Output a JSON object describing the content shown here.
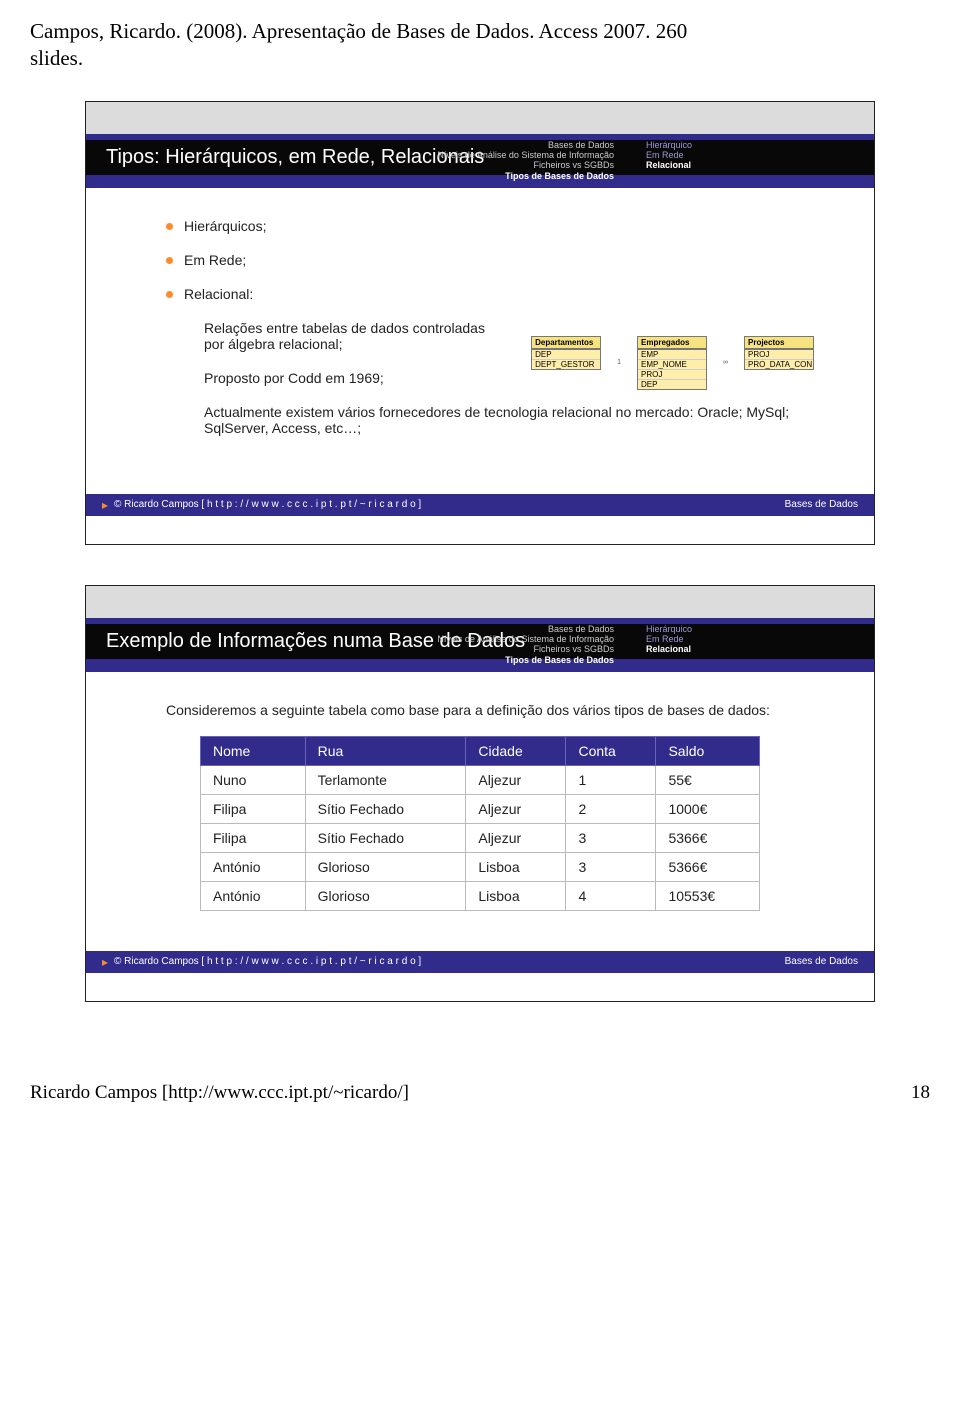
{
  "doc": {
    "citation_line1": "Campos, Ricardo. (2008). Apresentação de Bases de Dados. Access 2007. 260",
    "citation_line2": "slides.",
    "footer_ref": "Ricardo Campos [http://www.ccc.ipt.pt/~ricardo/]",
    "page_number": "18"
  },
  "crumbs_left": {
    "a": "Bases de Dados",
    "b": "Níveis de Análise do Sistema de Informação",
    "c": "Ficheiros vs SGBDs",
    "d": "Tipos de Bases de Dados"
  },
  "crumbs_right": {
    "a": "Hierárquico",
    "b": "Em Rede",
    "c": "Relacional"
  },
  "slide1": {
    "title": "Tipos: Hierárquicos, em Rede, Relacionais",
    "b1": "Hierárquicos;",
    "b2": "Em Rede;",
    "b3": "Relacional:",
    "s1": "Relações entre tabelas de dados controladas por álgebra relacional;",
    "s2": "Proposto por Codd em 1969;",
    "s3": "Actualmente existem vários fornecedores de tecnologia relacional no mercado: Oracle; MySql; SqlServer, Access, etc…;",
    "erd": {
      "dep_head": "Departamentos",
      "dep_r1": "DEP",
      "dep_r2": "DEPT_GESTOR",
      "emp_head": "Empregados",
      "emp_r1": "EMP",
      "emp_r2": "EMP_NOME",
      "emp_r3": "PROJ",
      "emp_r4": "DEP",
      "proj_head": "Projectos",
      "proj_r1": "PROJ",
      "proj_r2": "PRO_DATA_CON",
      "one": "1",
      "inf": "∞"
    },
    "footer_left": "© Ricardo Campos  [ h t t p : / / w w w . c c c . i p t . p t / ~ r i c a r d o ]",
    "footer_right": "Bases de Dados"
  },
  "slide2": {
    "title": "Exemplo de Informações numa Base de Dados",
    "intro": "Consideremos a seguinte tabela como base para a definição dos vários tipos de bases de dados:",
    "columns": [
      "Nome",
      "Rua",
      "Cidade",
      "Conta",
      "Saldo"
    ],
    "rows": [
      [
        "Nuno",
        "Terlamonte",
        "Aljezur",
        "1",
        "55€"
      ],
      [
        "Filipa",
        "Sítio Fechado",
        "Aljezur",
        "2",
        "1000€"
      ],
      [
        "Filipa",
        "Sítio Fechado",
        "Aljezur",
        "3",
        "5366€"
      ],
      [
        "António",
        "Glorioso",
        "Lisboa",
        "3",
        "5366€"
      ],
      [
        "António",
        "Glorioso",
        "Lisboa",
        "4",
        "10553€"
      ]
    ],
    "footer_left": "© Ricardo Campos  [ h t t p : / / w w w . c c c . i p t . p t / ~ r i c a r d o ]",
    "footer_right": "Bases de Dados"
  }
}
